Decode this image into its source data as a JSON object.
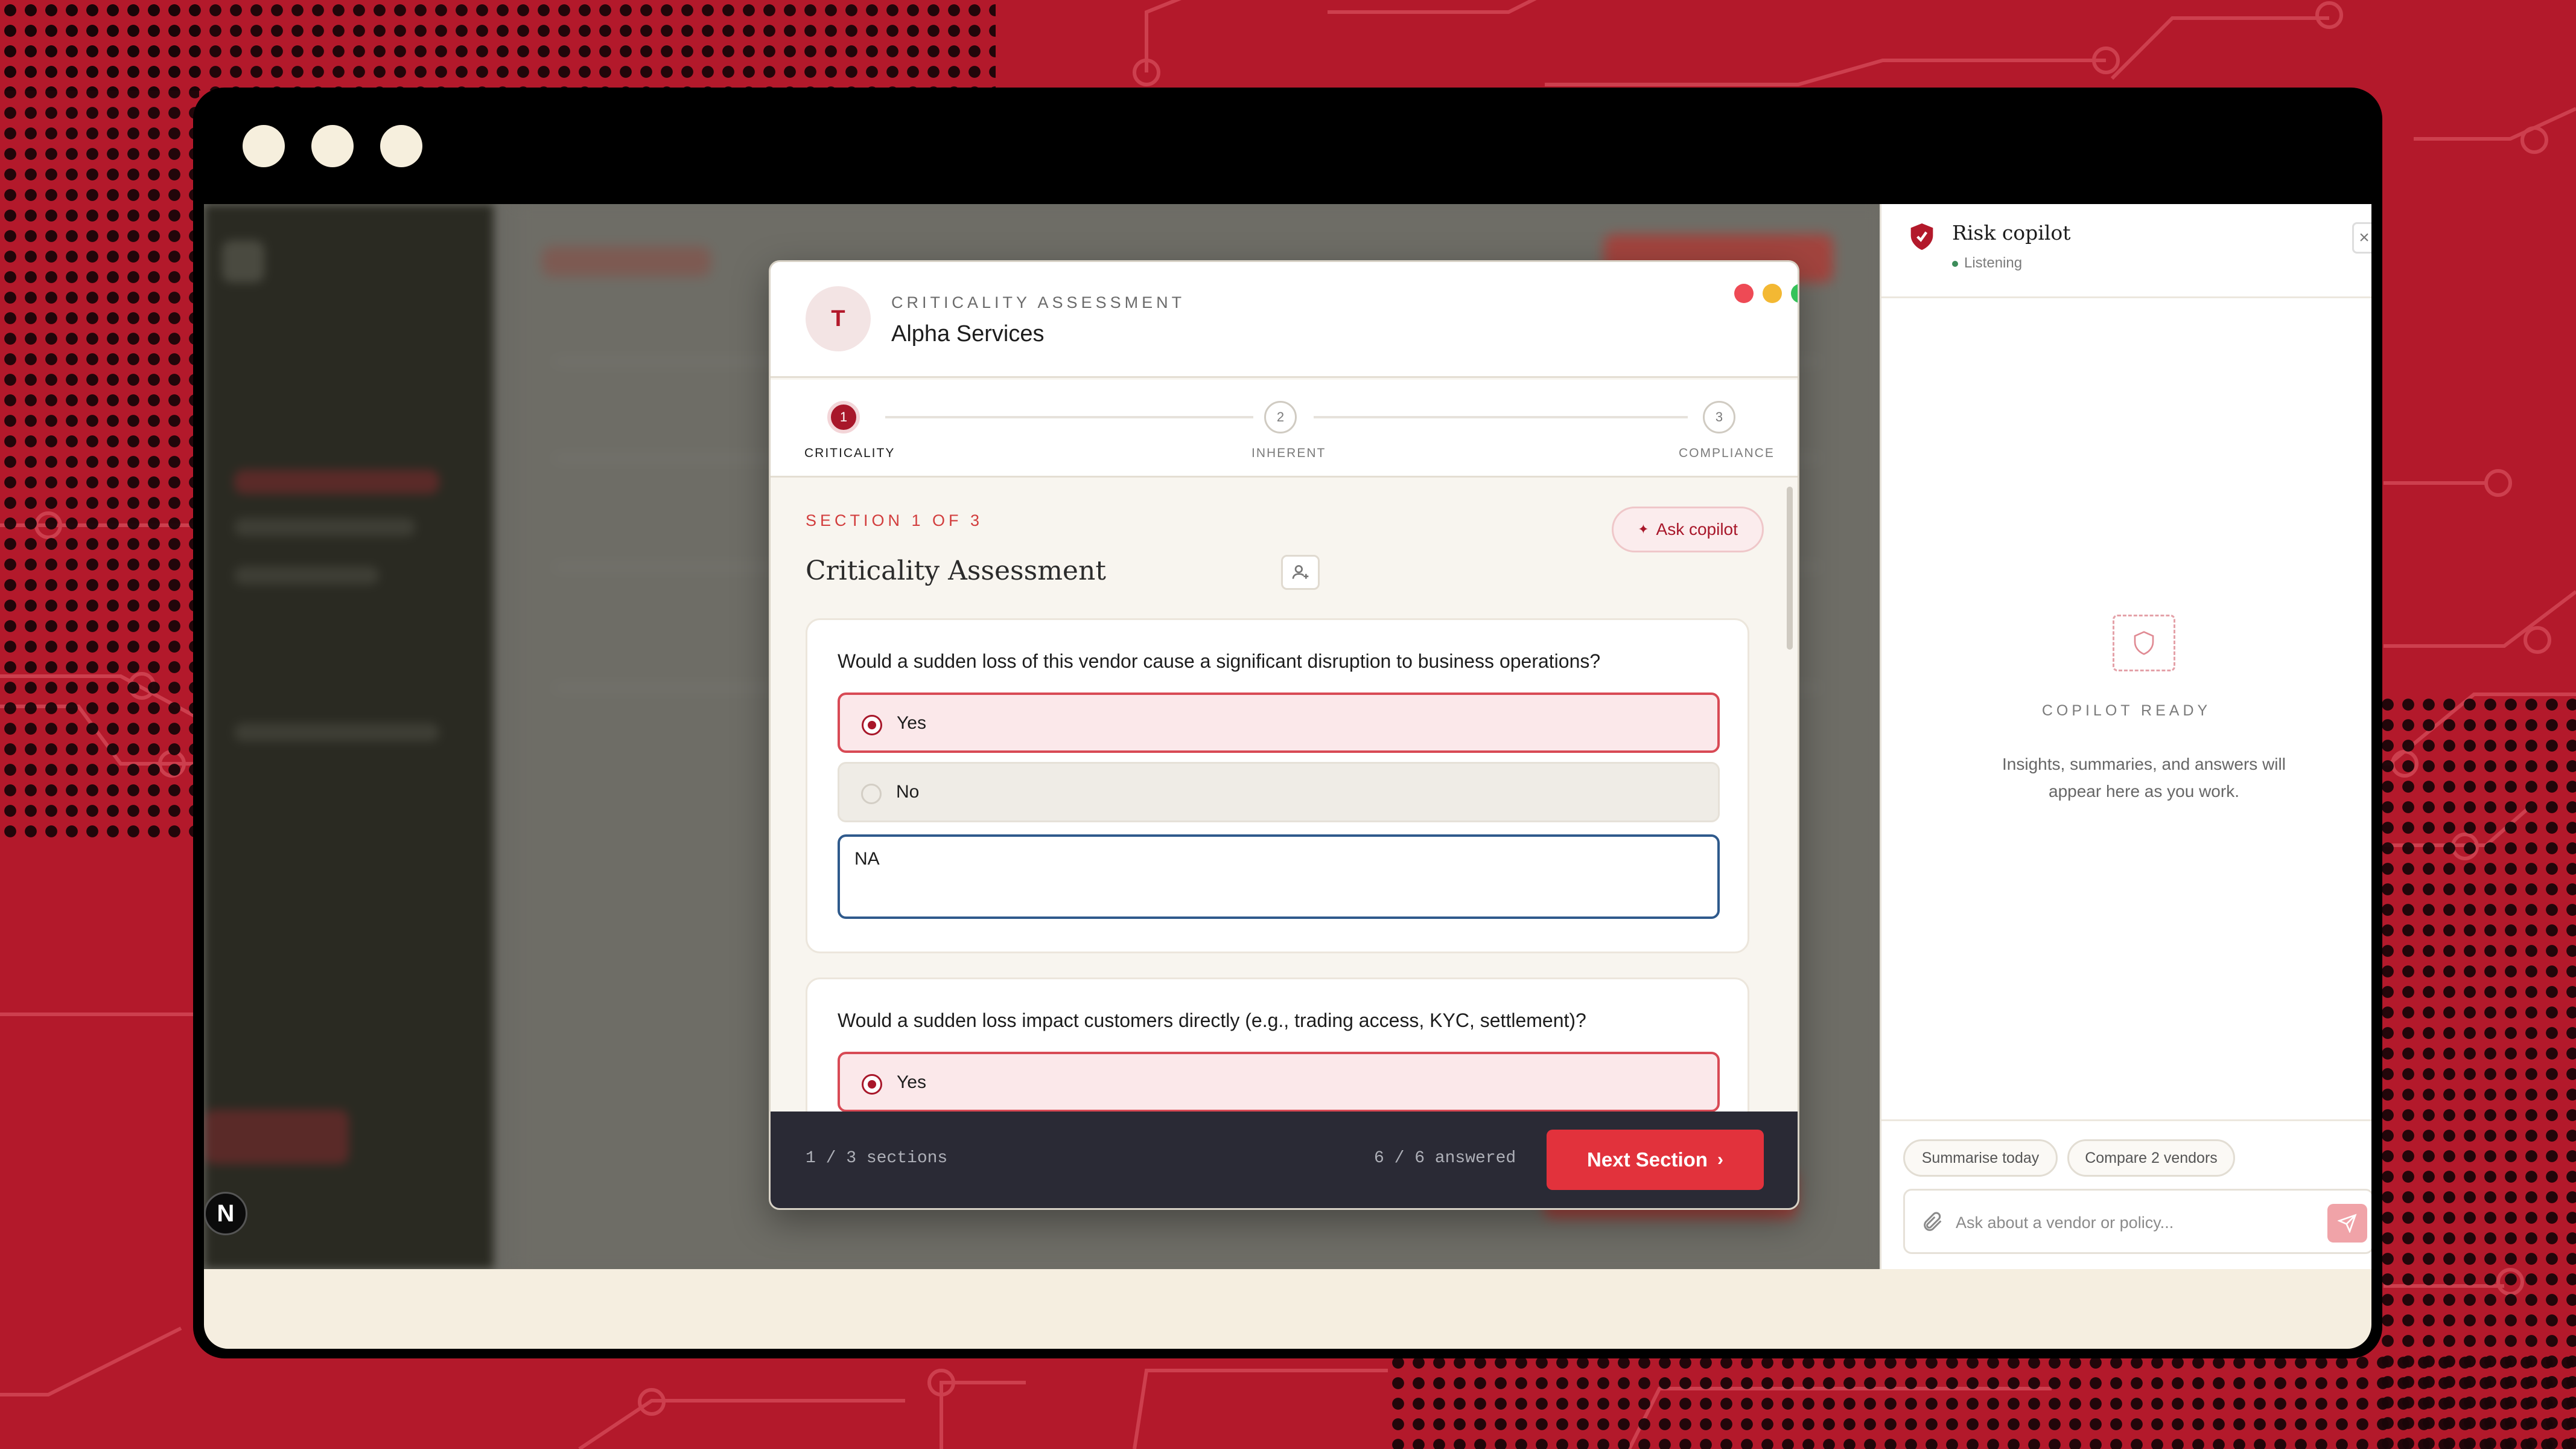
{
  "colors": {
    "brand_red": "#b3192b",
    "accent_red": "#e2323c",
    "footer_dark": "#2a2a35",
    "mac_red": "#ee4a55",
    "mac_yellow": "#f3b833",
    "mac_green": "#35c35a"
  },
  "app": {
    "n_badge": "N"
  },
  "modal": {
    "avatar_initial": "T",
    "kicker": "CRITICALITY ASSESSMENT",
    "vendor_name": "Alpha Services",
    "steps": [
      {
        "number": "1",
        "label": "CRITICALITY"
      },
      {
        "number": "2",
        "label": "INHERENT"
      },
      {
        "number": "3",
        "label": "COMPLIANCE"
      }
    ],
    "section_kicker": "SECTION 1 OF 3",
    "section_title": "Criticality Assessment",
    "ask_copilot_label": "Ask copilot",
    "questions": [
      {
        "text": "Would a sudden loss of this vendor cause a significant disruption to business operations?",
        "options": [
          "Yes",
          "No"
        ],
        "selected": "Yes",
        "comment": "NA"
      },
      {
        "text": "Would a sudden loss impact customers directly (e.g., trading access, KYC, settlement)?",
        "options": [
          "Yes"
        ],
        "selected": "Yes"
      }
    ],
    "footer": {
      "progress": "1 / 3 sections",
      "answered": "6 / 6 answered",
      "next_label": "Next Section"
    }
  },
  "copilot": {
    "title": "Risk copilot",
    "status": "Listening",
    "close_icon": "×",
    "ready_label": "COPILOT READY",
    "description": "Insights, summaries, and answers will appear here as you work.",
    "chips": [
      "Summarise today",
      "Compare 2 vendors"
    ],
    "input_placeholder": "Ask about a vendor or policy..."
  }
}
